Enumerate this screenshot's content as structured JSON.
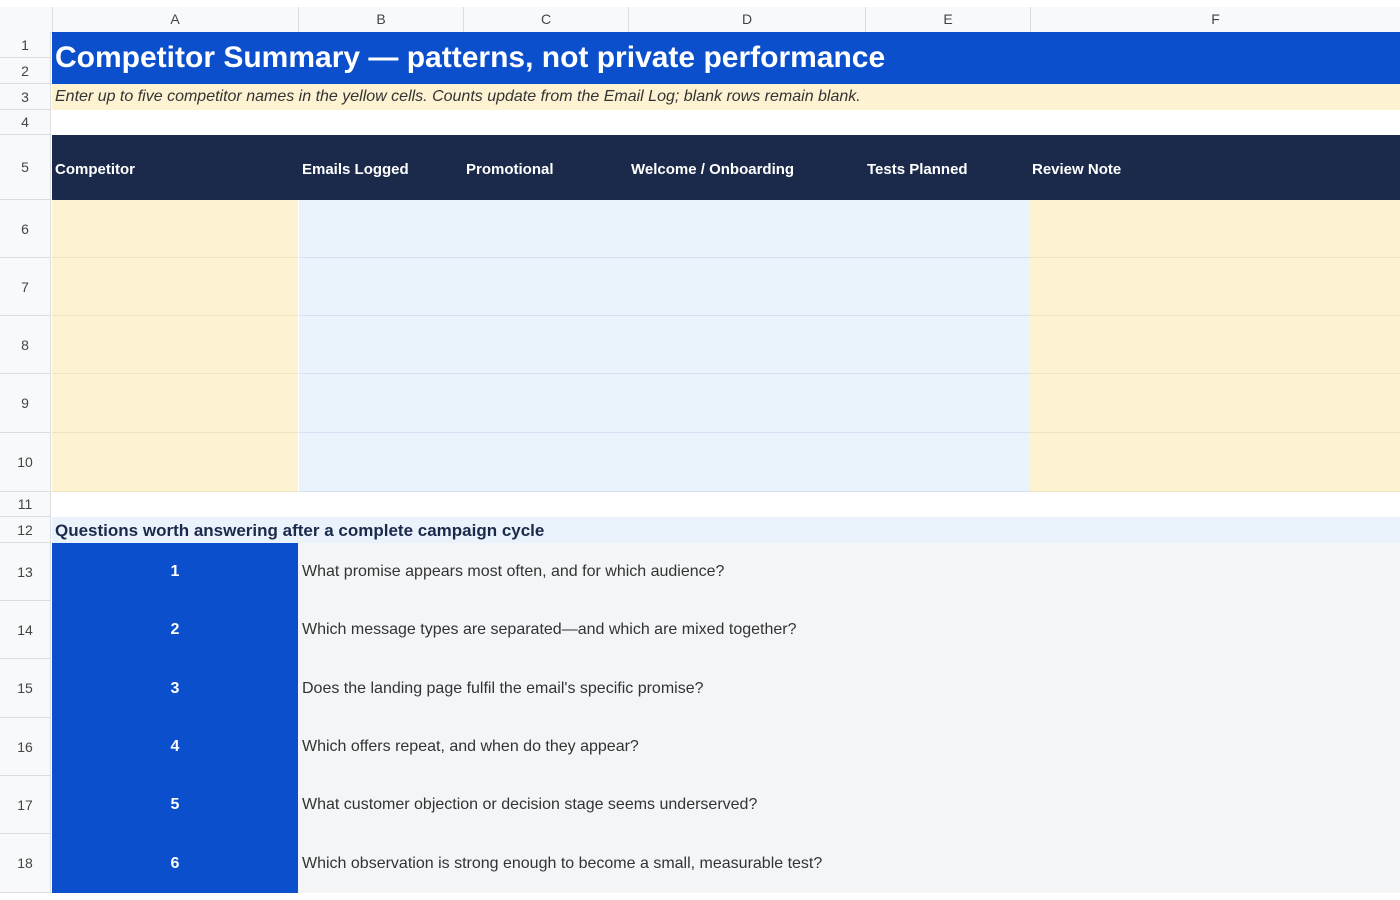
{
  "columns": [
    "A",
    "B",
    "C",
    "D",
    "E",
    "F"
  ],
  "rows": [
    "1",
    "2",
    "3",
    "4",
    "5",
    "6",
    "7",
    "8",
    "9",
    "10",
    "11",
    "12",
    "13",
    "14",
    "15",
    "16",
    "17",
    "18"
  ],
  "title": "Competitor Summary — patterns, not private performance",
  "instruction": "Enter up to five competitor names in the yellow cells. Counts update from the Email Log; blank rows remain blank.",
  "table_headers": {
    "competitor": "Competitor",
    "emails_logged": "Emails Logged",
    "promotional": "Promotional",
    "welcome": "Welcome / Onboarding",
    "tests_planned": "Tests Planned",
    "review_note": "Review Note"
  },
  "questions_heading": "Questions worth answering after a complete campaign cycle",
  "questions": [
    {
      "num": "1",
      "text": "What promise appears most often, and for which audience?"
    },
    {
      "num": "2",
      "text": "Which message types are separated—and which are mixed together?"
    },
    {
      "num": "3",
      "text": "Does the landing page fulfil the email's specific promise?"
    },
    {
      "num": "4",
      "text": "Which offers repeat, and when do they appear?"
    },
    {
      "num": "5",
      "text": "What customer objection or decision stage seems underserved?"
    },
    {
      "num": "6",
      "text": "Which observation is strong enough to become a small, measurable test?"
    }
  ],
  "colors": {
    "title_bg": "#0b4fcc",
    "header_bg": "#1b2a4a",
    "input_yellow": "#fdf3d3",
    "computed_blue": "#eaf2fc"
  }
}
